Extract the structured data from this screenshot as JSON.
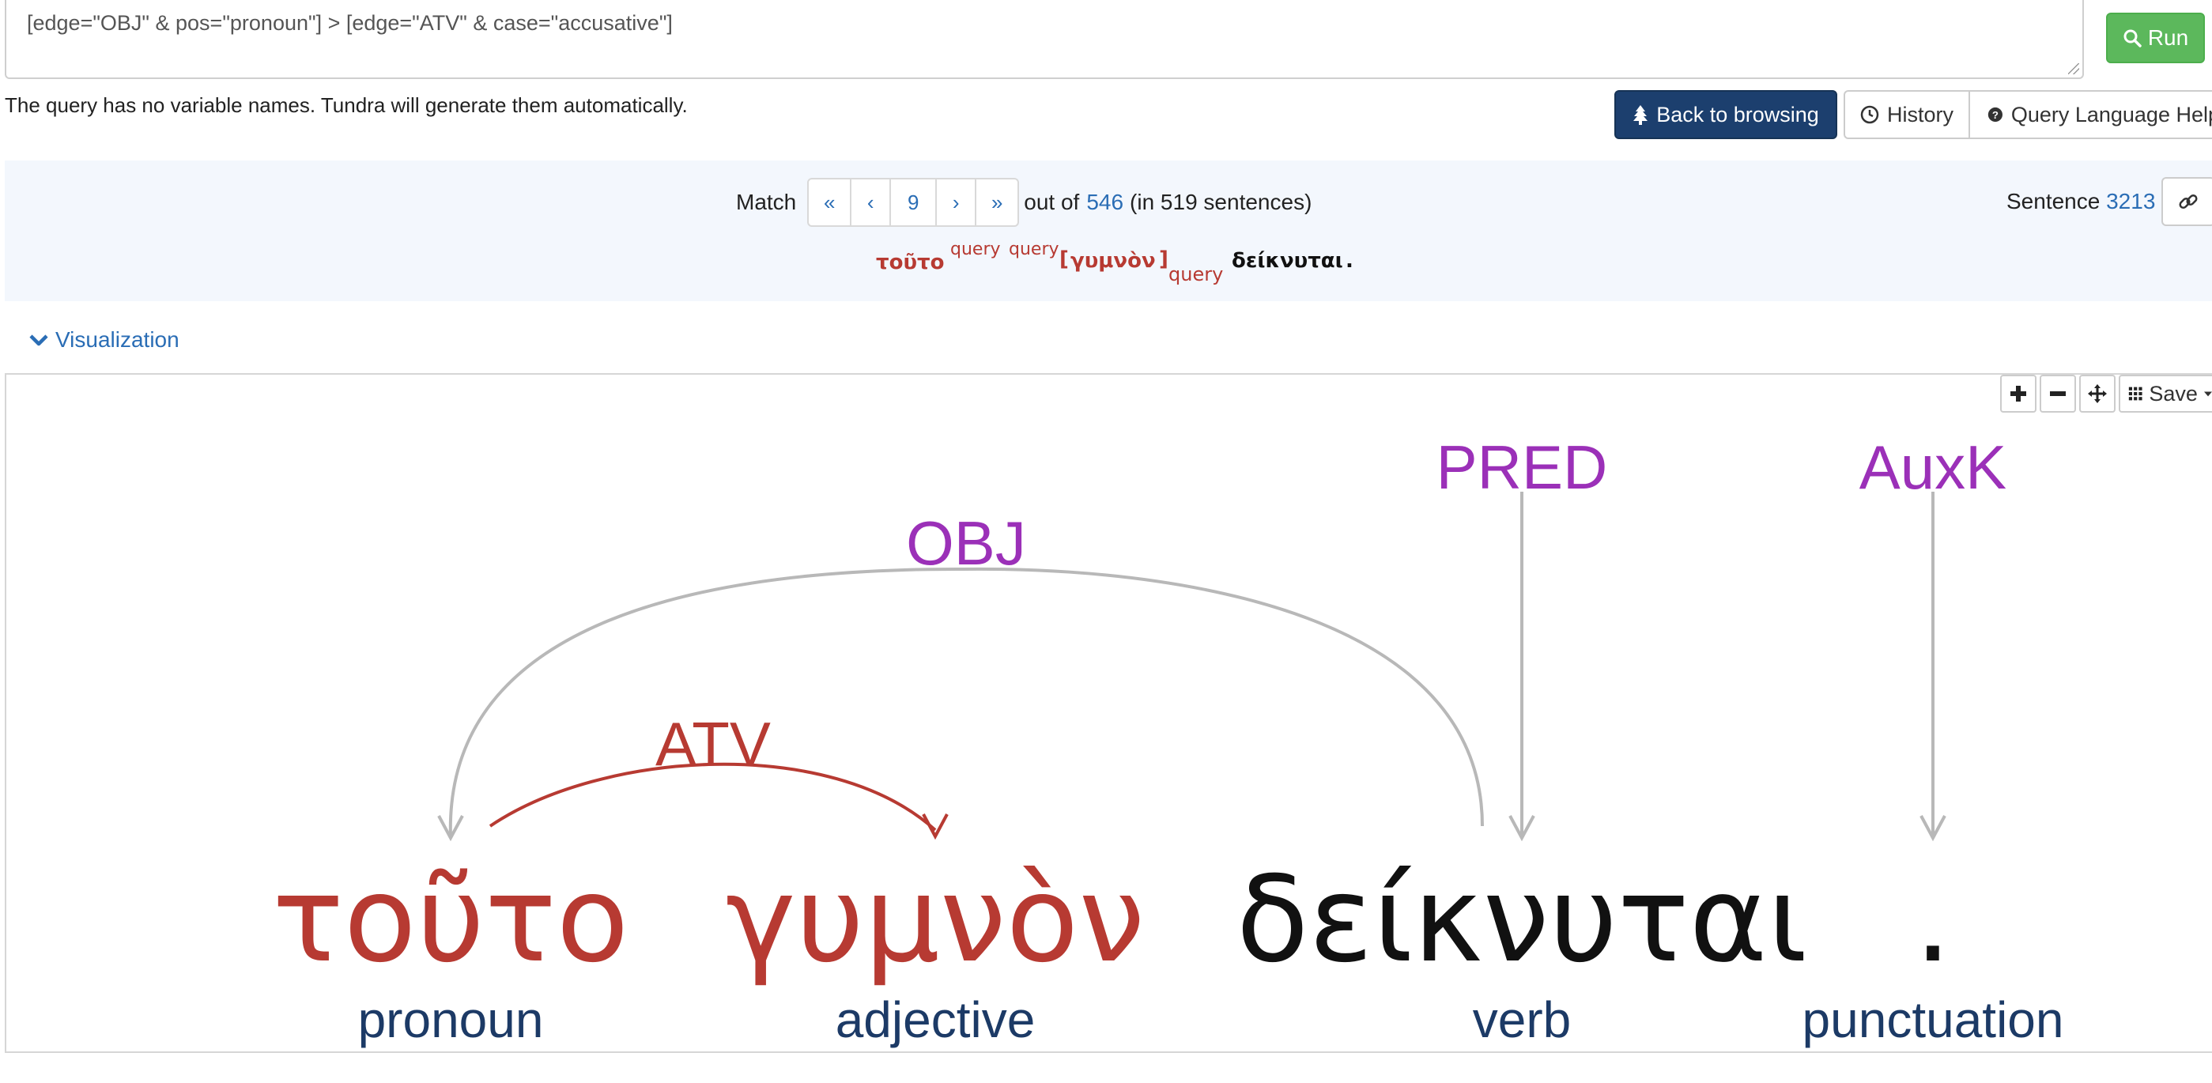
{
  "query": {
    "text": "[edge=\"OBJ\" & pos=\"pronoun\"] > [edge=\"ATV\" & case=\"accusative\"]",
    "run_label": "Run",
    "hint": "The query has no variable names. Tundra will generate them automatically."
  },
  "toolbar": {
    "back_label": "Back to browsing",
    "history_label": "History",
    "help_label": "Query Language Help"
  },
  "match": {
    "label": "Match",
    "first": "«",
    "prev": "‹",
    "current": "9",
    "next": "›",
    "last": "»",
    "out_of": "out of",
    "total": "546",
    "sentences_note": "(in 519 sentences)",
    "sentence_label": "Sentence",
    "sentence_id": "3213"
  },
  "sentence": {
    "w1": "τοῦτο",
    "sup1": "query",
    "sup2": "query",
    "open": "[",
    "w2": "γυμνὸν",
    "close": "]",
    "sub": "query",
    "w3": "δείκνυται",
    "w4": "."
  },
  "visualization": {
    "toggle_label": "Visualization",
    "save_label": "Save",
    "tokens": [
      {
        "word": "τοῦτο",
        "pos": "pronoun",
        "matched": true
      },
      {
        "word": "γυμνὸν",
        "pos": "adjective",
        "matched": true
      },
      {
        "word": "δείκνυται",
        "pos": "verb",
        "matched": false
      },
      {
        "word": ".",
        "pos": "punctuation",
        "matched": false
      }
    ],
    "edges": [
      {
        "label": "OBJ",
        "from": "δείκνυται",
        "to": "τοῦτο"
      },
      {
        "label": "ATV",
        "from": "τοῦτο",
        "to": "γυμνὸν"
      },
      {
        "label": "PRED",
        "from": "root",
        "to": "δείκνυται"
      },
      {
        "label": "AuxK",
        "from": "root",
        "to": "."
      }
    ]
  },
  "colors": {
    "match_red": "#b73a32",
    "edge_purple": "#9b30b8",
    "pos_navy": "#1c3a66",
    "arc_gray": "#b8b8b8",
    "link_blue": "#2a6db5"
  }
}
